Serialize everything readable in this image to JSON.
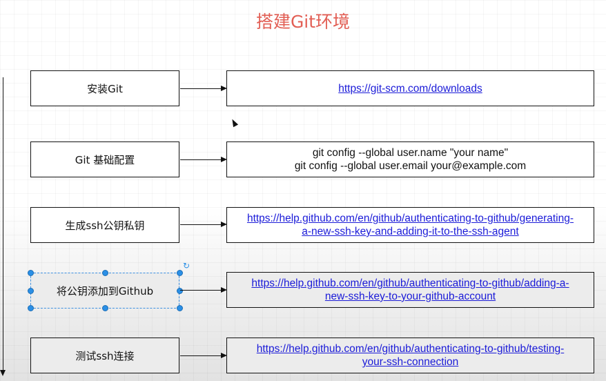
{
  "title": "搭建Git环境",
  "steps": [
    {
      "label": "安装Git",
      "target_lines": [
        "https://git-scm.com/downloads"
      ],
      "target_is_link": true
    },
    {
      "label": "Git 基础配置",
      "target_lines": [
        "git config --global user.name \"your name\"",
        "git config --global user.email your@example.com"
      ],
      "target_is_link": false
    },
    {
      "label": "生成ssh公钥私钥",
      "target_lines": [
        "https://help.github.com/en/github/authenticating-to-github/generating-",
        "a-new-ssh-key-and-adding-it-to-the-ssh-agent"
      ],
      "target_is_link": true
    },
    {
      "label": "将公钥添加到Github",
      "target_lines": [
        "https://help.github.com/en/github/authenticating-to-github/adding-a-",
        "new-ssh-key-to-your-github-account"
      ],
      "target_is_link": true
    },
    {
      "label": "测试ssh连接",
      "target_lines": [
        "https://help.github.com/en/github/authenticating-to-github/testing-",
        "your-ssh-connection"
      ],
      "target_is_link": true
    }
  ],
  "colors": {
    "title": "#e25f55",
    "link": "#1a1ad8",
    "selection": "#2a8fe6"
  },
  "icons": {
    "rotate": "rotate-icon",
    "cursor": "mouse-cursor-icon"
  }
}
